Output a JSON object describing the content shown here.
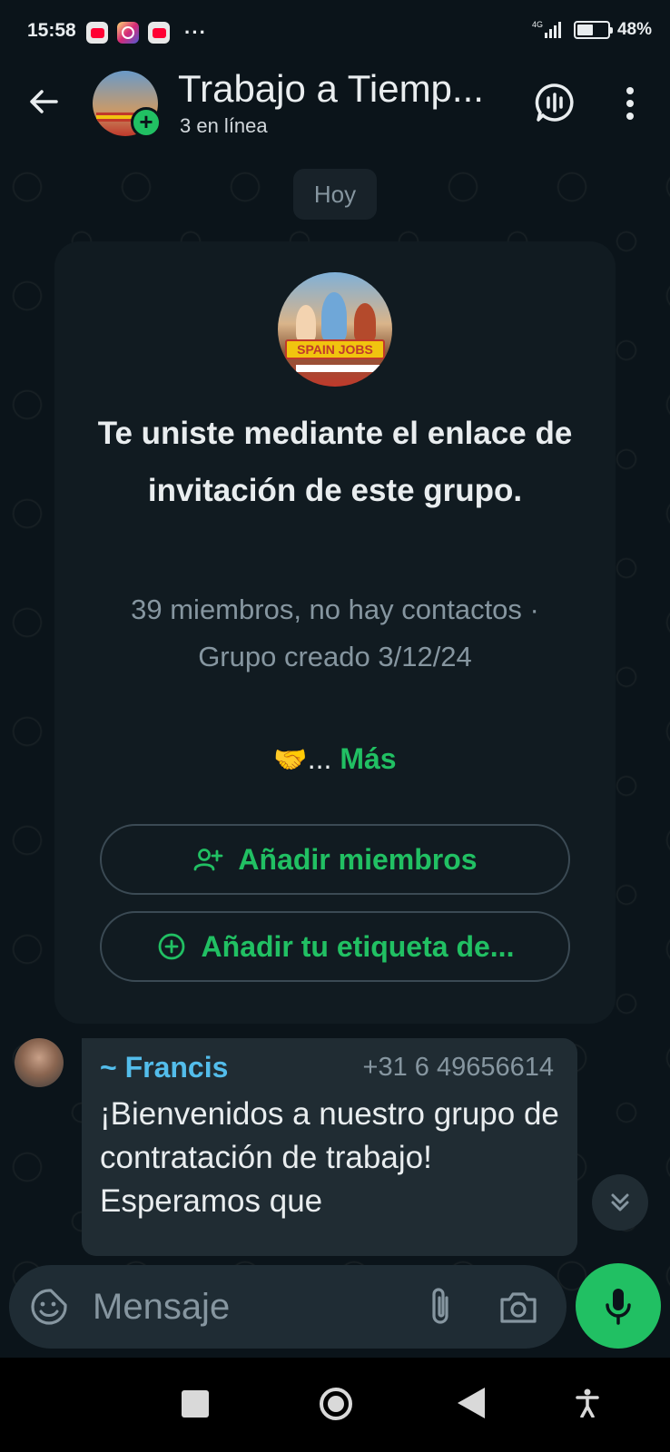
{
  "status_bar": {
    "time": "15:58",
    "apps": [
      "youtube-icon",
      "instagram-icon",
      "youtube-icon"
    ],
    "overflow": "···",
    "network": "4G",
    "battery": "48%"
  },
  "header": {
    "title": "Trabajo a Tiemp...",
    "subtitle": "3 en línea"
  },
  "chat": {
    "day_label": "Hoy",
    "group_card": {
      "avatar_banner": "SPAIN JOBS",
      "title": "Te uniste mediante el enlace de invitación de este grupo.",
      "meta": "39 miembros, no hay contactos · Grupo creado 3/12/24",
      "description_emoji": "🤝",
      "ellipsis": "...",
      "more_label": "Más",
      "add_members_label": "Añadir miembros",
      "add_tag_label": "Añadir tu etiqueta de..."
    },
    "message": {
      "sender": "~ Francis",
      "phone": "+31 6 49656614",
      "text": "¡Bienvenidos a nuestro grupo de contratación de trabajo! Esperamos que"
    }
  },
  "composer": {
    "placeholder": "Mensaje"
  },
  "colors": {
    "accent": "#21c063",
    "background": "#0b141a",
    "sender_name": "#53bdeb"
  }
}
